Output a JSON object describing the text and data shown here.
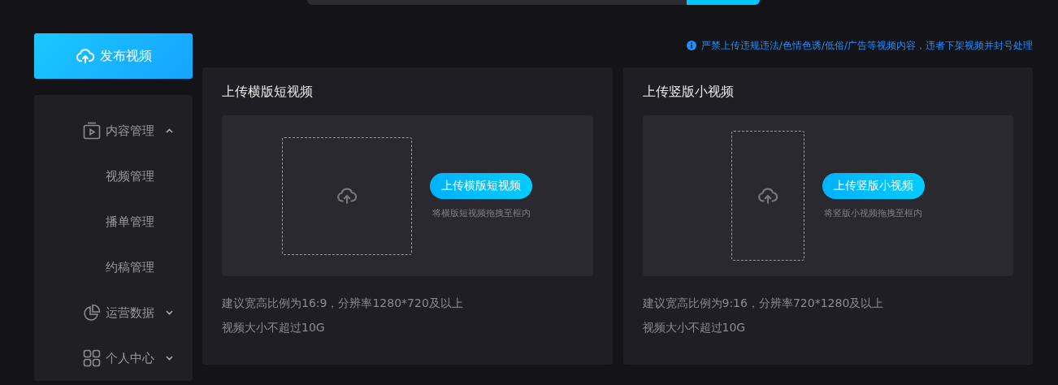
{
  "publish_button": {
    "label": "发布视频"
  },
  "sidebar": {
    "items": [
      {
        "label": "内容管理",
        "kind": "video",
        "expanded": true,
        "children": [
          {
            "label": "视频管理"
          },
          {
            "label": "播单管理"
          },
          {
            "label": "约稿管理"
          }
        ]
      },
      {
        "label": "运营数据",
        "kind": "chart",
        "expanded": false
      },
      {
        "label": "个人中心",
        "kind": "grid",
        "expanded": false
      }
    ]
  },
  "notice": "严禁上传违规违法/色情色诱/低俗/广告等视频内容，违者下架视频并封号处理",
  "upload_cards": [
    {
      "kind": "landscape",
      "title": "上传横版短视频",
      "button": "上传横版短视频",
      "hint": "将横版短视频拖拽至框内",
      "notes": [
        "建议宽高比例为16:9，分辨率1280*720及以上",
        "视频大小不超过10G"
      ]
    },
    {
      "kind": "portrait",
      "title": "上传竖版小视频",
      "button": "上传竖版小视频",
      "hint": "将竖版小视频拖拽至框内",
      "notes": [
        "建议宽高比例为9:16，分辨率720*1280及以上",
        "视频大小不超过10G"
      ]
    }
  ]
}
